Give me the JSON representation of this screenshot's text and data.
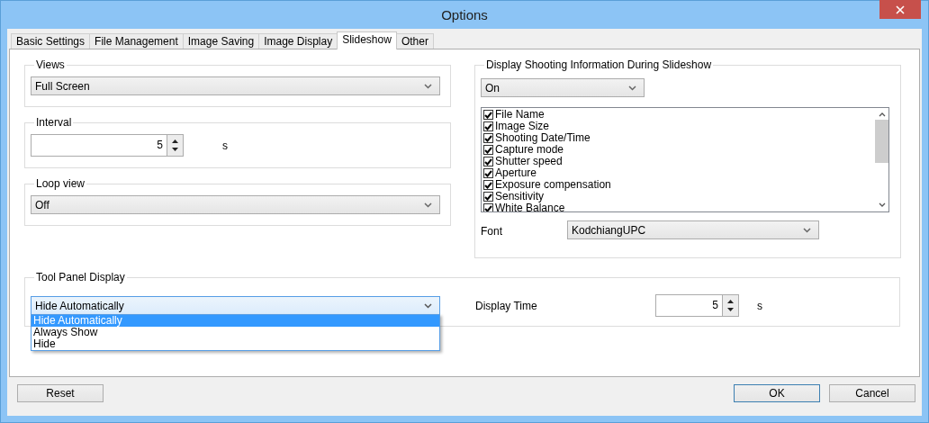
{
  "window": {
    "title": "Options"
  },
  "tabs": [
    {
      "label": "Basic Settings",
      "selected": false
    },
    {
      "label": "File Management",
      "selected": false
    },
    {
      "label": "Image Saving",
      "selected": false
    },
    {
      "label": "Image Display",
      "selected": false
    },
    {
      "label": "Slideshow",
      "selected": true
    },
    {
      "label": "Other",
      "selected": false
    }
  ],
  "views": {
    "label": "Views",
    "value": "Full Screen"
  },
  "interval": {
    "label": "Interval",
    "value": "5",
    "unit": "s"
  },
  "loop_view": {
    "label": "Loop view",
    "value": "Off"
  },
  "shooting_info": {
    "label": "Display Shooting Information During Slideshow",
    "value": "On",
    "font_label": "Font",
    "font_value": "KodchiangUPC",
    "items": [
      {
        "label": "File Name",
        "checked": true
      },
      {
        "label": "Image Size",
        "checked": true
      },
      {
        "label": "Shooting Date/Time",
        "checked": true
      },
      {
        "label": "Capture mode",
        "checked": true
      },
      {
        "label": "Shutter speed",
        "checked": true
      },
      {
        "label": "Aperture",
        "checked": true
      },
      {
        "label": "Exposure compensation",
        "checked": true
      },
      {
        "label": "Sensitivity",
        "checked": true
      },
      {
        "label": "White Balance",
        "checked": true
      }
    ]
  },
  "tool_panel": {
    "label": "Tool Panel Display",
    "value": "Hide Automatically",
    "expanded": true,
    "options": [
      {
        "label": "Hide Automatically",
        "selected": true
      },
      {
        "label": "Always Show",
        "selected": false
      },
      {
        "label": "Hide",
        "selected": false
      }
    ],
    "display_time_label": "Display Time",
    "display_time_value": "5",
    "unit": "s"
  },
  "buttons": [
    {
      "label": "Reset",
      "default": false
    },
    {
      "label": "OK",
      "default": true
    },
    {
      "label": "Cancel",
      "default": false
    }
  ]
}
